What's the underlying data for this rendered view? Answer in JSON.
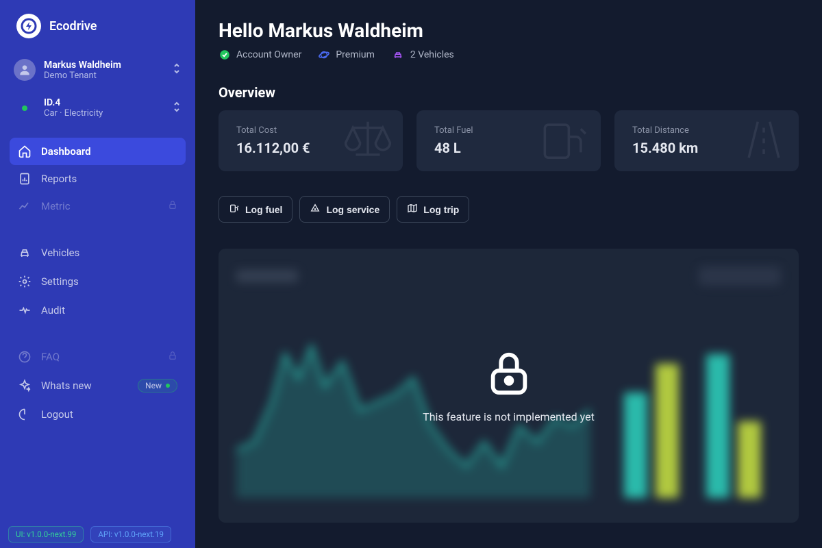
{
  "app": {
    "name": "Ecodrive"
  },
  "user": {
    "name": "Markus Waldheim",
    "tenant": "Demo Tenant"
  },
  "vehicle": {
    "name": "ID.4",
    "sub": "Car  ·  Electricity"
  },
  "nav": {
    "dashboard": "Dashboard",
    "reports": "Reports",
    "metric": "Metric",
    "vehicles": "Vehicles",
    "settings": "Settings",
    "audit": "Audit",
    "faq": "FAQ",
    "whatsnew": "Whats new",
    "logout": "Logout",
    "new_badge": "New"
  },
  "versions": {
    "ui": "UI: v1.0.0-next.99",
    "api": "API: v1.0.0-next.19"
  },
  "greeting": "Hello Markus Waldheim",
  "badges": {
    "owner": "Account Owner",
    "premium": "Premium",
    "vehicles": "2 Vehicles"
  },
  "overview": {
    "title": "Overview",
    "total_cost": {
      "label": "Total Cost",
      "value": "16.112,00 €"
    },
    "total_fuel": {
      "label": "Total Fuel",
      "value": "48 L"
    },
    "total_distance": {
      "label": "Total Distance",
      "value": "15.480 km"
    }
  },
  "actions": {
    "log_fuel": "Log fuel",
    "log_service": "Log service",
    "log_trip": "Log trip"
  },
  "locked": {
    "message": "This feature is not implemented yet"
  }
}
